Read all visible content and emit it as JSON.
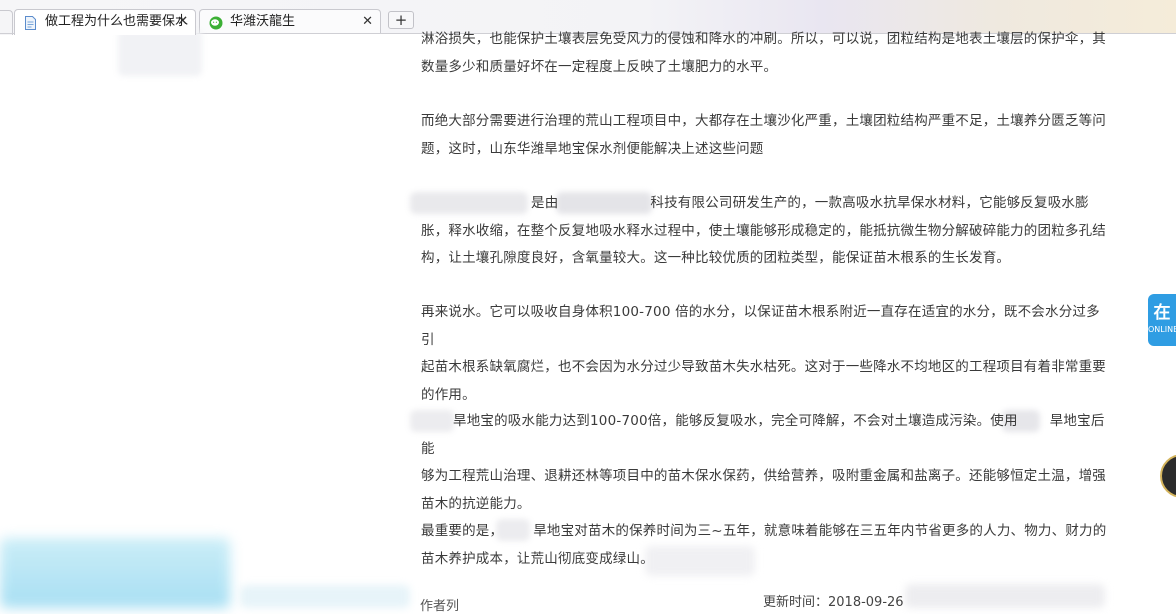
{
  "tabs": [
    {
      "label": "做工程为什么也需要保水",
      "icon": "document-icon",
      "active": true
    },
    {
      "label": "华潍沃龍生",
      "icon": "wechat-icon",
      "active": false
    }
  ],
  "close_glyph": "✕",
  "new_tab_glyph": "+",
  "article": {
    "p1_line1": "淋浴损失，也能保护土壤表层免受风力的侵蚀和降水的冲刷。所以，可以说，团粒结构是地表土壤层的保护伞，其",
    "p1_line2": "数量多少和质量好坏在一定程度上反映了土壤肥力的水平。",
    "p2_line1": "而绝大部分需要进行治理的荒山工程项目中，大都存在土壤沙化严重，土壤团粒结构严重不足，土壤养分匮乏等问",
    "p2_line2": "题，这时，山东华潍旱地宝保水剂便能解决上述这些问题",
    "p3_line1a": "是由",
    "p3_line1b": "科技有限公司研发生产的，一款高吸水抗旱保水材料，它能够反复吸水膨",
    "p3_line2": "胀，释水收缩，在整个反复地吸水释水过程中，使土壤能够形成稳定的，能抵抗微生物分解破碎能力的团粒多孔结",
    "p3_line3": "构，让土壤孔隙度良好，含氧量较大。这一种比较优质的团粒类型，能保证苗木根系的生长发育。",
    "p4_line1": "再来说水。它可以吸收自身体积100-700 倍的水分，以保证苗木根系附近一直存在适宜的水分，既不会水分过多引",
    "p4_line2": "起苗木根系缺氧腐烂，也不会因为水分过少导致苗木失水枯死。这对于一些降水不均地区的工程项目有着非常重要",
    "p4_line3": "的作用。",
    "p5_line1a": "旱地宝的吸水能力达到100-700倍，能够反复吸水，完全可降解，不会对土壤造成污染。使用",
    "p5_line1b": "旱地宝后能",
    "p5_line2": "够为工程荒山治理、退耕还林等项目中的苗木保水保药，供给营养，吸附重金属和盐离子。还能够恒定土温，增强",
    "p5_line3": "苗木的抗逆能力。",
    "p6_line1a": "最重要的是，",
    "p6_line1b": "旱地宝对苗木的保养时间为三~五年，就意味着能够在三五年内节省更多的人力、物力、财力的",
    "p6_line2": "苗木养护成本，让荒山彻底变成绿山。"
  },
  "footer": {
    "update_label": "更新时间：2018-09-26",
    "author_label": "作者列"
  },
  "online_widget": {
    "big": "在",
    "small": "ONLINE"
  },
  "colors": {
    "online_blue": "#2f9de3",
    "text": "#3a3a3a"
  }
}
